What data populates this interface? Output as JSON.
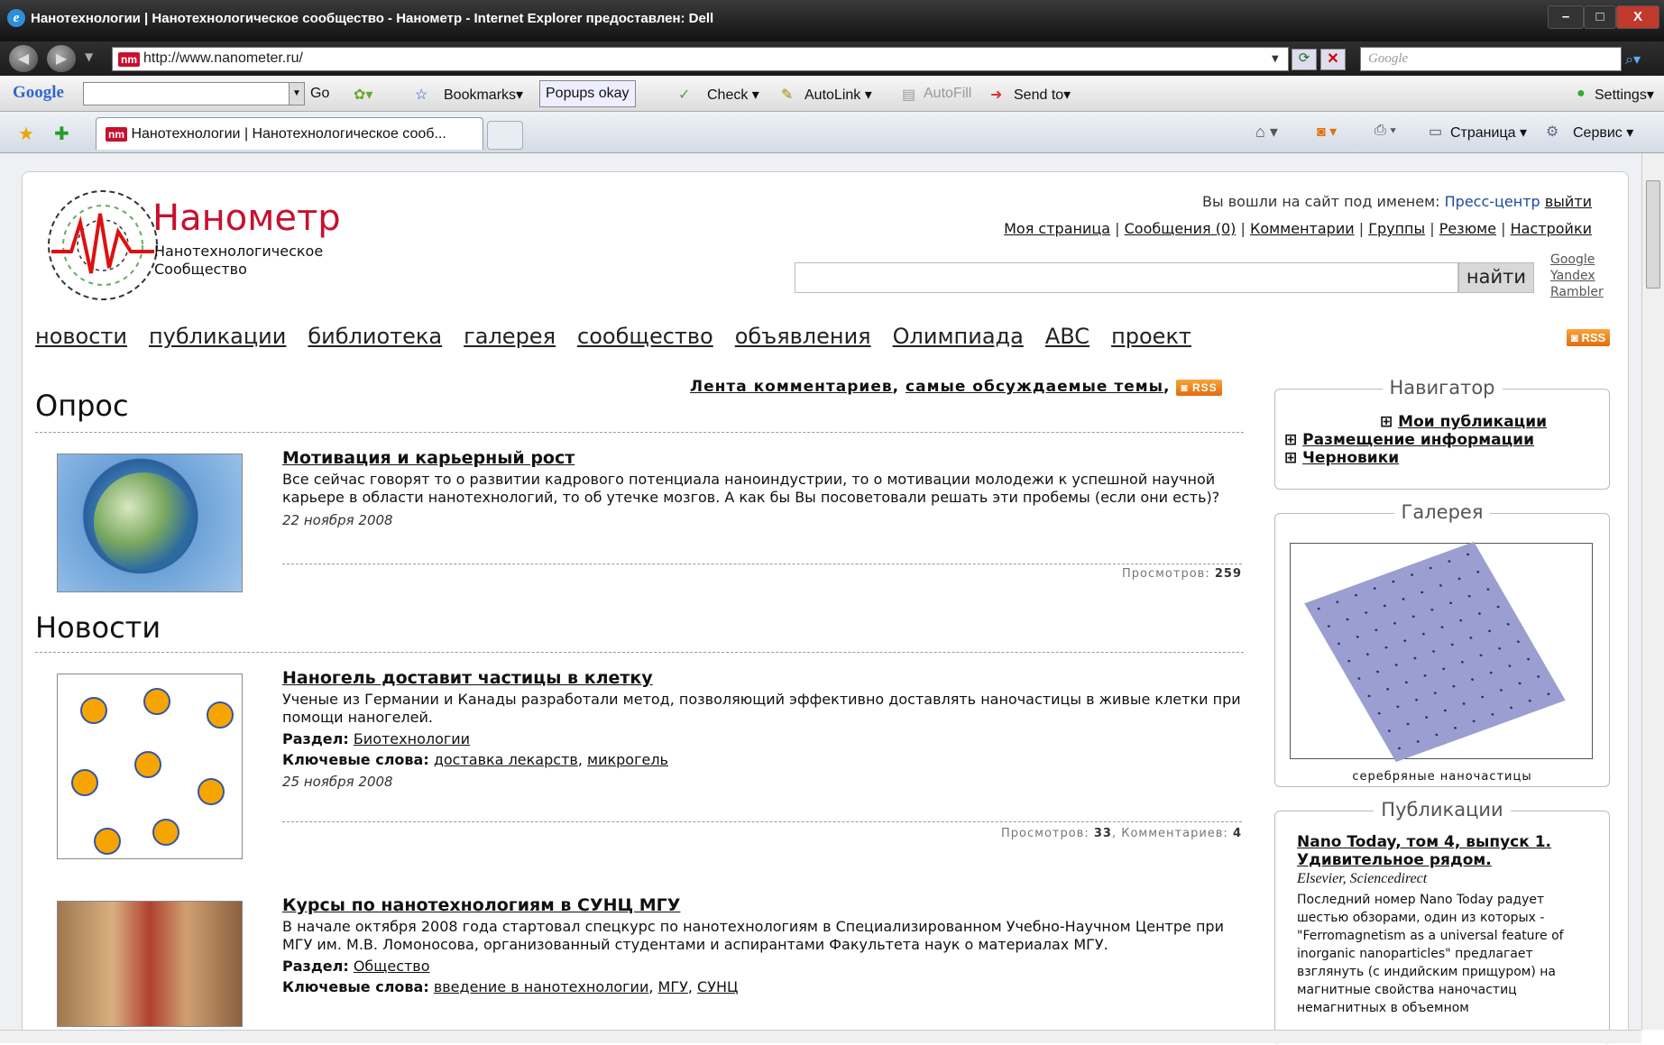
{
  "window": {
    "title": "Нанотехнологии | Нанотехнологическое сообщество - Нанометр - Internet Explorer предоставлен: Dell",
    "minimize": "–",
    "maximize": "□",
    "close": "X"
  },
  "address": {
    "url": "http://www.nanometer.ru/",
    "search_placeholder": "Google"
  },
  "toolbar": {
    "google": "Google",
    "go": "Go",
    "bookmarks": "Bookmarks▾",
    "popups": "Popups okay",
    "check": "Check ▾",
    "autolink": "AutoLink ▾",
    "autofill": "AutoFill",
    "sendto": "Send to▾",
    "settings": "Settings▾"
  },
  "tab": {
    "label": "Нанотехнологии | Нанотехнологическое сооб...",
    "page_menu": "Страница ▾",
    "tools_menu": "Сервис ▾"
  },
  "site": {
    "logo_title": "Нанометр",
    "logo_sub1": "Нанотехнологическое",
    "logo_sub2": "Сообщество",
    "logo_mark": "nM",
    "login_text": "Вы вошли на сайт под именем:",
    "login_user": "Пресс-центр",
    "logout": "выйти",
    "user_links": [
      "Моя страница",
      "Сообщения (0)",
      "Комментарии",
      "Группы",
      "Резюме",
      "Настройки"
    ],
    "search_button": "найти",
    "engines": [
      "Google",
      "Yandex",
      "Rambler"
    ],
    "nav": [
      "новости",
      "публикации",
      "библиотека",
      "галерея",
      "сообщество",
      "объявления",
      "Олимпиада",
      "ABC",
      "проект"
    ],
    "rss": "RSS"
  },
  "comments_bar": {
    "feed": "Лента комментариев",
    "hot": "самые обсуждаемые темы",
    "sep": ","
  },
  "poll": {
    "heading": "Опрос",
    "title": "Мотивация и карьерный рост",
    "desc": "Все сейчас говорят то о развитии кадрового потенциала наноиндустрии, то о мотивации молодежи к успешной научной карьере в области нанотехнологий, то об утечке мозгов. А как бы Вы посоветовали решать эти пробемы (если они есть)?",
    "date": "22 ноября 2008",
    "views_label": "Просмотров:",
    "views": "259"
  },
  "news": {
    "heading": "Новости",
    "items": [
      {
        "title": "Наногель доставит частицы в клетку",
        "desc": "Ученые из Германии и Канады разработали метод, позволяющий эффективно доставлять наночастицы в живые клетки при помощи наногелей.",
        "section_label": "Раздел:",
        "section": "Биотехнологии",
        "kw_label": "Ключевые слова:",
        "kw1": "доставка лекарств",
        "kw_sep": ",",
        "kw2": "микрогель",
        "date": "25 ноября 2008",
        "views_label": "Просмотров:",
        "views": "33",
        "comments_label": "Комментариев:",
        "comments": "4"
      },
      {
        "title": "Курсы по нанотехнологиям в СУНЦ МГУ",
        "desc": "В начале октября 2008 года стартовал спецкурс по нанотехнологиям в Специализированном Учебно-Научном Центре при МГУ им. М.В. Ломоносова, организованный студентами и аспирантами Факультета наук о материалах МГУ.",
        "section_label": "Раздел:",
        "section": "Общество",
        "kw_label": "Ключевые слова:",
        "kw1": "введение в нанотехнологии",
        "kw_sep": ",",
        "kw2": "МГУ",
        "kw3": "СУНЦ"
      }
    ]
  },
  "sidebar": {
    "navigator": {
      "title": "Навигатор",
      "items": [
        "Мои публикации",
        "Размещение информации",
        "Черновики"
      ]
    },
    "gallery": {
      "title": "Галерея",
      "caption": "серебряные наночастицы"
    },
    "publications": {
      "title": "Публикации",
      "item_title": "Nano Today, том 4, выпуск 1. Удивительное рядом.",
      "source": "Elsevier, Sciencedirect",
      "text": "Последний номер Nano Today радует шестью обзорами, один из которых - \"Ferromagnetism as a universal feature of inorganic nanoparticles\" предлагает взглянуть (с индийским прищуром) на магнитные свойства наночастиц немагнитных в объемном"
    }
  }
}
